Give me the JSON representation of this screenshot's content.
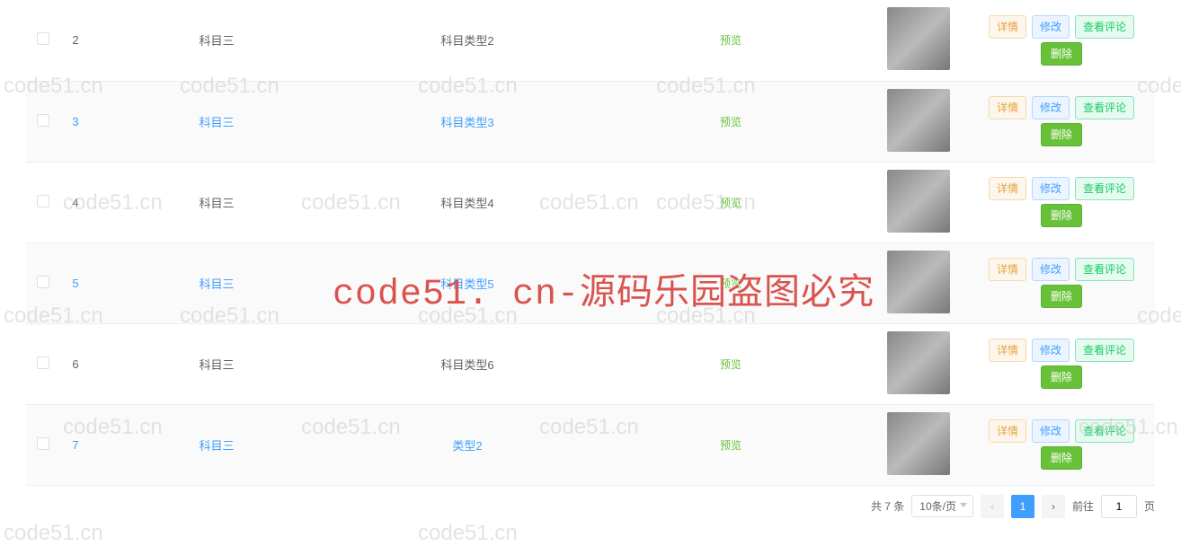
{
  "rows": [
    {
      "index": "2",
      "name": "科目三",
      "type": "科目类型2",
      "preview": "预览",
      "link": false
    },
    {
      "index": "3",
      "name": "科目三",
      "type": "科目类型3",
      "preview": "预览",
      "link": true
    },
    {
      "index": "4",
      "name": "科目三",
      "type": "科目类型4",
      "preview": "预览",
      "link": false
    },
    {
      "index": "5",
      "name": "科目三",
      "type": "科目类型5",
      "preview": "预览",
      "link": true
    },
    {
      "index": "6",
      "name": "科目三",
      "type": "科目类型6",
      "preview": "预览",
      "link": false
    },
    {
      "index": "7",
      "name": "科目三",
      "type": "类型2",
      "preview": "预览",
      "link": true
    }
  ],
  "actions": {
    "detail": "详情",
    "edit": "修改",
    "comments": "查看评论",
    "delete": "删除"
  },
  "pagination": {
    "total_text": "共 7 条",
    "page_size": "10条/页",
    "current": "1",
    "goto_prefix": "前往",
    "goto_value": "1",
    "goto_suffix": "页",
    "prev": "‹",
    "next": "›"
  },
  "watermark": {
    "small": "code51.cn",
    "big": "code51. cn-源码乐园盗图必究"
  }
}
